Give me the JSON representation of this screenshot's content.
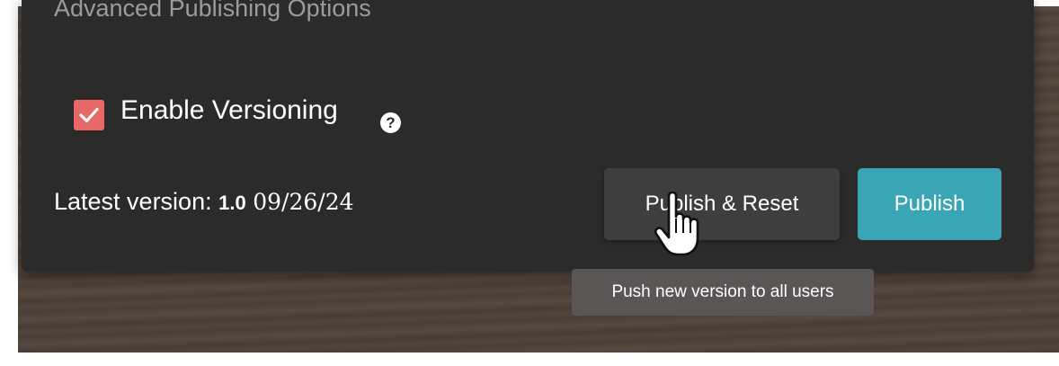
{
  "section": {
    "title": "Advanced Publishing Options"
  },
  "versioning": {
    "label": "Enable Versioning",
    "checked": true,
    "checkbox_color": "#e86767",
    "help_glyph": "?"
  },
  "latest": {
    "label": "Latest version:",
    "version": "1.0",
    "date": "09/26/24"
  },
  "buttons": {
    "publish_reset": "Publish & Reset",
    "publish": "Publish",
    "publish_color": "#3aa5b5"
  },
  "tooltip": {
    "text": "Push new version to all users"
  },
  "cursor": {
    "icon": "hand-pointer-icon"
  }
}
